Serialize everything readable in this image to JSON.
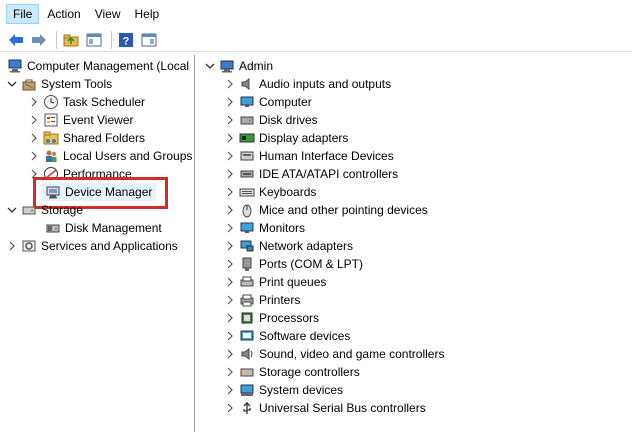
{
  "menu": {
    "file": "File",
    "action": "Action",
    "view": "View",
    "help": "Help"
  },
  "toolbar": {
    "back_icon": "back-arrow-icon",
    "forward_icon": "forward-arrow-icon",
    "up_icon": "up-folder-icon",
    "show_hide_icon": "show-hide-tree-icon",
    "help_icon": "help-icon",
    "properties_icon": "properties-icon"
  },
  "left_tree": {
    "root": "Computer Management (Local",
    "system_tools": "System Tools",
    "task_scheduler": "Task Scheduler",
    "event_viewer": "Event Viewer",
    "shared_folders": "Shared Folders",
    "local_users": "Local Users and Groups",
    "performance": "Performance",
    "device_manager": "Device Manager",
    "storage": "Storage",
    "disk_management": "Disk Management",
    "services": "Services and Applications"
  },
  "right_tree": {
    "root": "Admin",
    "items": [
      "Audio inputs and outputs",
      "Computer",
      "Disk drives",
      "Display adapters",
      "Human Interface Devices",
      "IDE ATA/ATAPI controllers",
      "Keyboards",
      "Mice and other pointing devices",
      "Monitors",
      "Network adapters",
      "Ports (COM & LPT)",
      "Print queues",
      "Printers",
      "Processors",
      "Software devices",
      "Sound, video and game controllers",
      "Storage controllers",
      "System devices",
      "Universal Serial Bus controllers"
    ]
  },
  "colors": {
    "highlight_border": "#d42a2a",
    "menu_active": "#cce8ff"
  }
}
